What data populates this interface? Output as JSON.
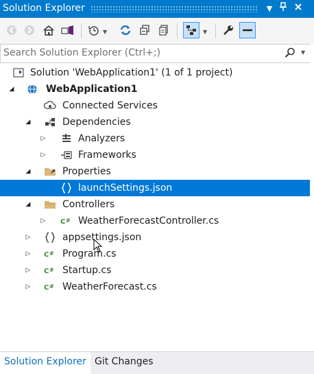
{
  "window": {
    "title": "Solution Explorer",
    "controls": {
      "dropdown": "▾",
      "pin": "📌",
      "close": "✕"
    }
  },
  "toolbar": {
    "buttons": [
      "back-icon",
      "forward-icon",
      "home-icon",
      "vs-switch-views-icon",
      "pending-changes-filter-icon",
      "sync-with-active-document-icon",
      "refresh-icon",
      "collapse-all-icon",
      "show-all-files-icon",
      "preview-selected-items-icon",
      "properties-icon",
      "show-all-icon"
    ]
  },
  "search": {
    "placeholder": "Search Solution Explorer (Ctrl+;)"
  },
  "tree": {
    "items": [
      {
        "label": "Solution 'WebApplication1' (1 of 1 project)",
        "icon": "solution-icon",
        "level": 0,
        "expander": ""
      },
      {
        "label": "WebApplication1",
        "icon": "web-project-icon",
        "level": 0,
        "expander": "◢",
        "bold": true
      },
      {
        "label": "Connected Services",
        "icon": "connected-services-icon",
        "level": 1,
        "expander": ""
      },
      {
        "label": "Dependencies",
        "icon": "dependencies-icon",
        "level": 1,
        "expander": "◢"
      },
      {
        "label": "Analyzers",
        "icon": "analyzers-icon",
        "level": 2,
        "expander": "▷"
      },
      {
        "label": "Frameworks",
        "icon": "frameworks-icon",
        "level": 2,
        "expander": "▷"
      },
      {
        "label": "Properties",
        "icon": "properties-folder-icon",
        "level": 1,
        "expander": "◢"
      },
      {
        "label": "launchSettings.json",
        "icon": "json-file-icon",
        "level": 2,
        "expander": "",
        "selected": true
      },
      {
        "label": "Controllers",
        "icon": "folder-icon",
        "level": 1,
        "expander": "◢"
      },
      {
        "label": "WeatherForecastController.cs",
        "icon": "csharp-file-icon",
        "level": 2,
        "expander": "▷"
      },
      {
        "label": "appsettings.json",
        "icon": "json-file-icon",
        "level": 1,
        "expander": "▷"
      },
      {
        "label": "Program.cs",
        "icon": "csharp-file-icon",
        "level": 1,
        "expander": "▷"
      },
      {
        "label": "Startup.cs",
        "icon": "csharp-file-icon",
        "level": 1,
        "expander": "▷"
      },
      {
        "label": "WeatherForecast.cs",
        "icon": "csharp-file-icon",
        "level": 1,
        "expander": "▷"
      }
    ]
  },
  "bottom_tabs": [
    {
      "label": "Solution Explorer",
      "active": true
    },
    {
      "label": "Git Changes",
      "active": false
    }
  ],
  "colors": {
    "title_bar": "#007acc",
    "selection": "#0078d7",
    "active_tab_text": "#0e70c0"
  }
}
